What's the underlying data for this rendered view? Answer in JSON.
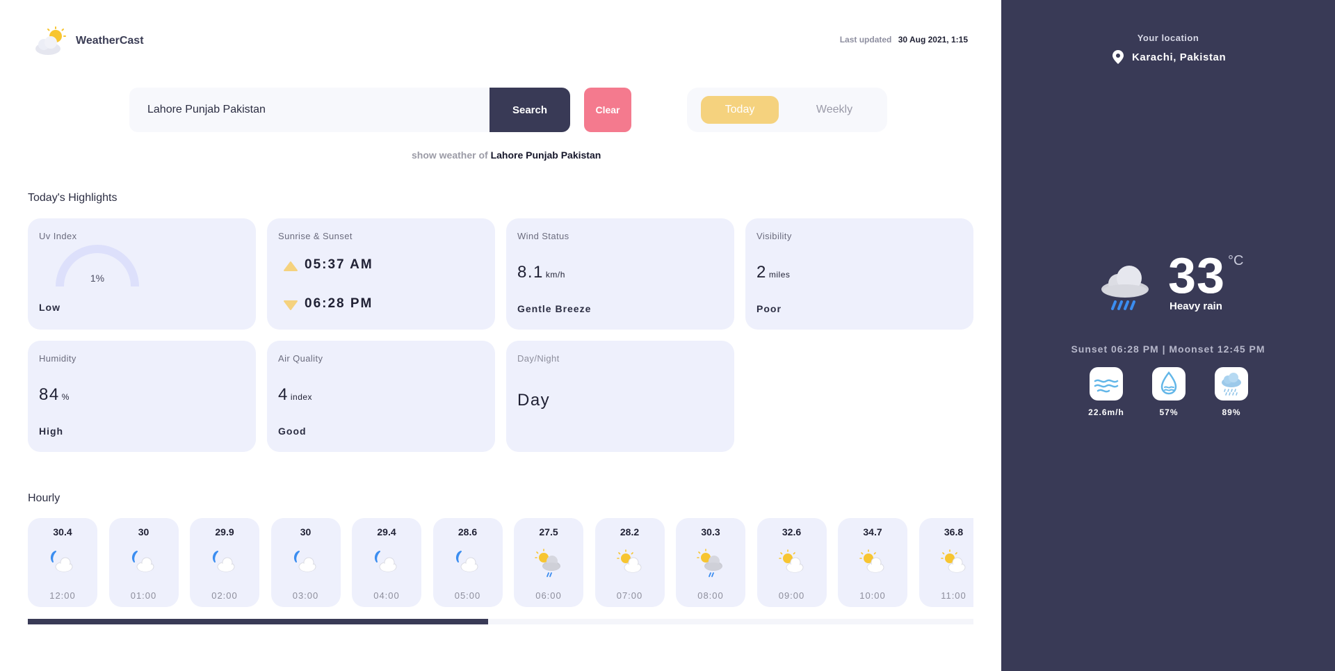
{
  "app": {
    "name": "WeatherCast"
  },
  "header": {
    "last_updated_label": "Last updated",
    "last_updated_value": "30 Aug 2021, 1:15"
  },
  "search": {
    "value": "Lahore Punjab Pakistan",
    "button_label": "Search",
    "clear_label": "Clear"
  },
  "view_toggle": {
    "today_label": "Today",
    "weekly_label": "Weekly",
    "active": "Today"
  },
  "show_weather": {
    "prefix": "show weather of",
    "location": "Lahore Punjab Pakistan"
  },
  "highlights": {
    "title": "Today's Highlights",
    "uv": {
      "label": "Uv Index",
      "value": "1%",
      "desc": "Low"
    },
    "sun": {
      "label": "Sunrise & Sunset",
      "sunrise": "05:37 AM",
      "sunset": "06:28 PM"
    },
    "wind": {
      "label": "Wind Status",
      "value": "8.1",
      "unit": "km/h",
      "desc": "Gentle Breeze"
    },
    "visibility": {
      "label": "Visibility",
      "value": "2",
      "unit": "miles",
      "desc": "Poor"
    },
    "humidity": {
      "label": "Humidity",
      "value": "84",
      "unit": "%",
      "desc": "High"
    },
    "air": {
      "label": "Air Quality",
      "value": "4",
      "unit": "index",
      "desc": "Good"
    },
    "daynight": {
      "label": "Day/Night",
      "value": "Day"
    }
  },
  "hourly": {
    "title": "Hourly",
    "items": [
      {
        "temp": "30.4",
        "time": "12:00",
        "icon": "night-cloud-icon"
      },
      {
        "temp": "30",
        "time": "01:00",
        "icon": "night-cloud-icon"
      },
      {
        "temp": "29.9",
        "time": "02:00",
        "icon": "night-cloud-icon"
      },
      {
        "temp": "30",
        "time": "03:00",
        "icon": "night-cloud-icon"
      },
      {
        "temp": "29.4",
        "time": "04:00",
        "icon": "night-cloud-icon"
      },
      {
        "temp": "28.6",
        "time": "05:00",
        "icon": "night-cloud-icon"
      },
      {
        "temp": "27.5",
        "time": "06:00",
        "icon": "sun-rain-cloud-icon"
      },
      {
        "temp": "28.2",
        "time": "07:00",
        "icon": "sun-cloud-icon"
      },
      {
        "temp": "30.3",
        "time": "08:00",
        "icon": "sun-rain-cloud-icon"
      },
      {
        "temp": "32.6",
        "time": "09:00",
        "icon": "sun-cloud-icon"
      },
      {
        "temp": "34.7",
        "time": "10:00",
        "icon": "sun-cloud-icon"
      },
      {
        "temp": "36.8",
        "time": "11:00",
        "icon": "sun-cloud-icon"
      }
    ]
  },
  "sidebar": {
    "your_location_label": "Your location",
    "location": "Karachi, Pakistan",
    "temperature": "33",
    "unit": "°C",
    "condition": "Heavy rain",
    "sun_moon": "Sunset 06:28 PM |  Moonset 12:45 PM",
    "metrics": [
      {
        "icon": "wind-icon",
        "value": "22.6m/h"
      },
      {
        "icon": "humidity-drop-icon",
        "value": "57%"
      },
      {
        "icon": "rain-cloud-icon",
        "value": "89%"
      }
    ]
  },
  "colors": {
    "sidebar_bg": "#393a56",
    "card_bg": "#eef0fc",
    "accent_yellow": "#f5d27e",
    "clear_pink": "#f47a8e"
  }
}
